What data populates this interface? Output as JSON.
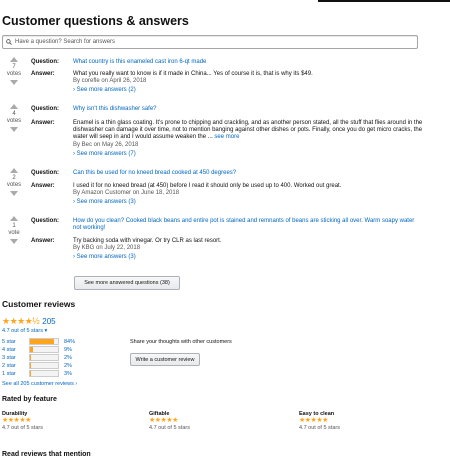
{
  "qa": {
    "title": "Customer questions & answers",
    "search_placeholder": "Have a question? Search for answers",
    "question_label": "Question:",
    "answer_label": "Answer:",
    "items": [
      {
        "votes": "7",
        "votes_label": "votes",
        "question": "What country is this enameled cast iron 6-qt made",
        "answer": "What you really want to know is if it made in China... Yes of course it is, that is why its $49.",
        "by": "By corefle on April 26, 2018",
        "see_more": "› See more answers (2)"
      },
      {
        "votes": "4",
        "votes_label": "votes",
        "question": "Why isn't this dishwasher safe?",
        "answer": "Enamel is a thin glass coating. It's prone to chipping and crackling, and as another person stated, all the stuff that flies around in the dishwasher can damage it over time, not to mention banging against other dishes or pots. Finally, once you do get micro cracks, the water will seep in and I would assume weaken the ...",
        "answer_more": "see more",
        "by": "By Bec on May 26, 2018",
        "see_more": "› See more answers (7)"
      },
      {
        "votes": "2",
        "votes_label": "votes",
        "question": "Can this be used for no kneed bread cooked at 450 degrees?",
        "answer": "I used it for no kneed bread (at 450) before I read it should only be used up to 400. Worked out great.",
        "by": "By Amazon Customer on June 18, 2018",
        "see_more": "› See more answers (3)"
      },
      {
        "votes": "1",
        "votes_label": "vote",
        "question": "How do you clean? Cooked black beans and entire pot is stained and remnants of beans are sticking all over. Warm soapy water not working!",
        "answer": "Try backing soda with vinegar. Or try CLR as last resort.",
        "by": "By KBG on July 22, 2018",
        "see_more": "› See more answers (3)"
      }
    ],
    "more_button": "See more answered questions (38)"
  },
  "reviews": {
    "title": "Customer reviews",
    "stars": "★★★★½",
    "count": "205",
    "rating_text": "4.7 out of 5 stars ▾",
    "histogram": [
      {
        "label": "5 star",
        "pct_text": "84%",
        "pct": 84
      },
      {
        "label": "4 star",
        "pct_text": "9%",
        "pct": 9
      },
      {
        "label": "3 star",
        "pct_text": "2%",
        "pct": 2
      },
      {
        "label": "2 star",
        "pct_text": "2%",
        "pct": 2
      },
      {
        "label": "1 star",
        "pct_text": "3%",
        "pct": 3
      }
    ],
    "see_all": "See all 205 customer reviews ›",
    "share_text": "Share your thoughts with other customers",
    "write_button": "Write a customer review",
    "feature_title": "Rated by feature",
    "features": [
      {
        "name": "Durability",
        "stars": "★★★★★",
        "rating": "4.7 out of 5 stars"
      },
      {
        "name": "Giftable",
        "stars": "★★★★★",
        "rating": "4.7 out of 5 stars"
      },
      {
        "name": "Easy to clean",
        "stars": "★★★★★",
        "rating": "4.7 out of 5 stars"
      }
    ],
    "mention_title": "Read reviews that mention"
  },
  "colors": {
    "link": "#0066c0",
    "star": "#ffa41c"
  }
}
